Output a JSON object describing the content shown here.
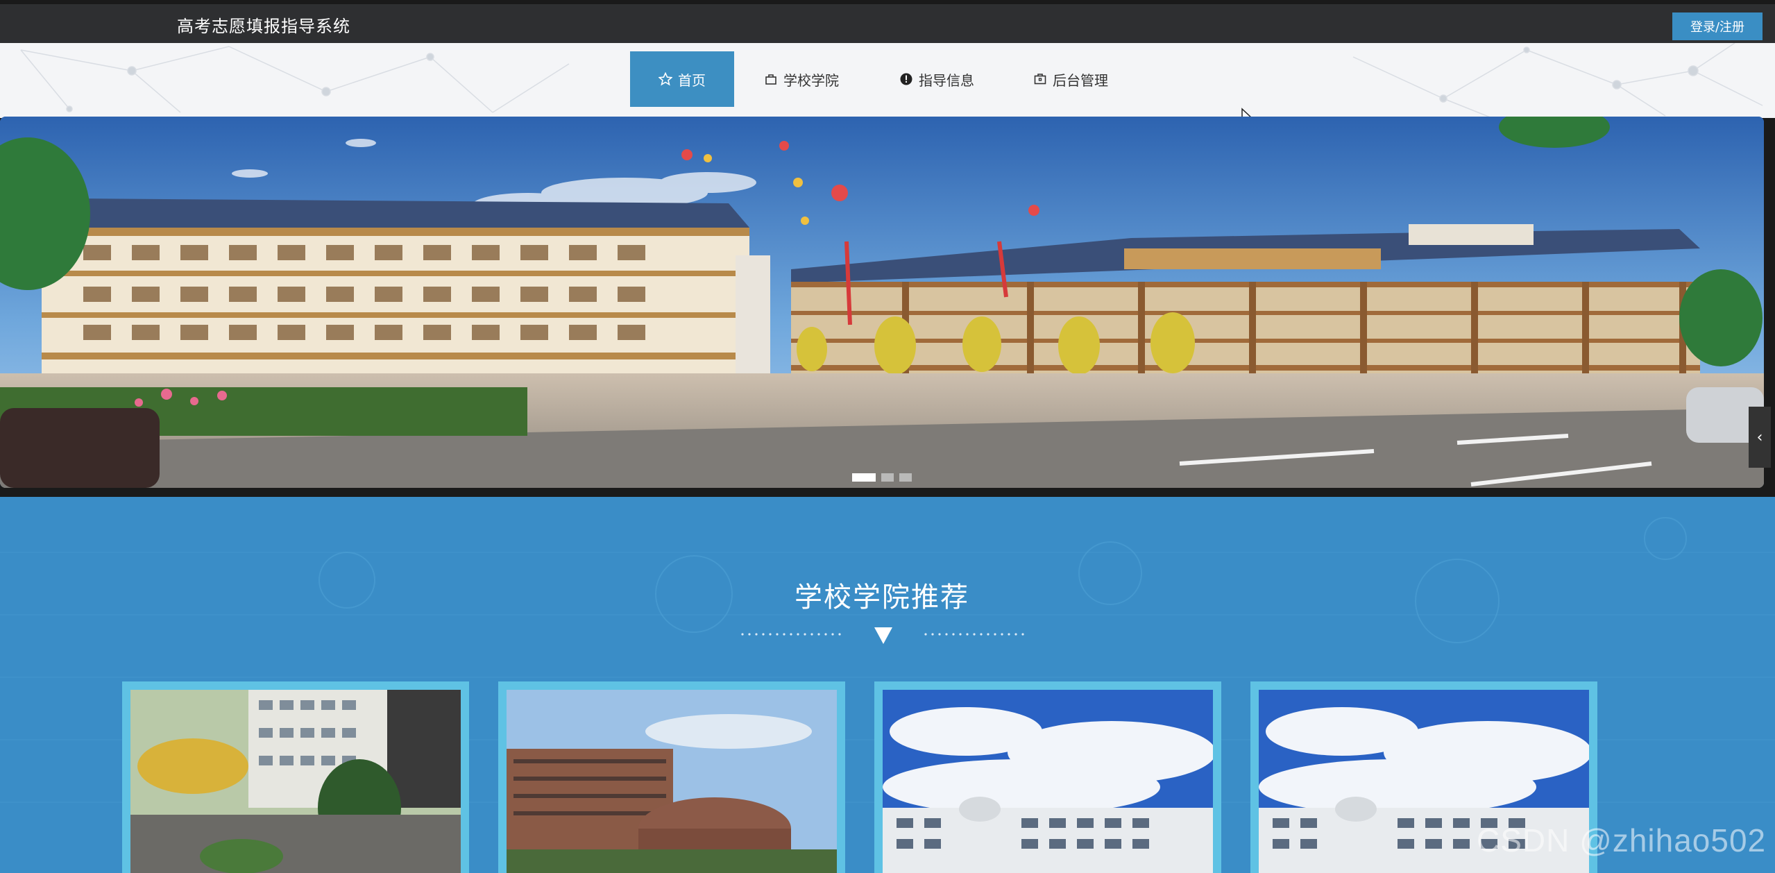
{
  "header": {
    "site_title": "高考志愿填报指导系统",
    "login_label": "登录/注册"
  },
  "nav": {
    "items": [
      {
        "label": "首页",
        "icon": "star-icon",
        "active": true
      },
      {
        "label": "学校学院",
        "icon": "bag-icon",
        "active": false
      },
      {
        "label": "指导信息",
        "icon": "info-icon",
        "active": false
      },
      {
        "label": "后台管理",
        "icon": "briefcase-icon",
        "active": false
      }
    ]
  },
  "banner": {
    "slide_count": 3,
    "active_slide": 1
  },
  "recommend": {
    "title": "学校学院推荐",
    "cards": [
      {
        "image": "campus-photo-1"
      },
      {
        "image": "campus-photo-2"
      },
      {
        "image": "campus-photo-3"
      },
      {
        "image": "campus-photo-4"
      }
    ]
  },
  "watermark": "CSDN @zhihao502",
  "colors": {
    "topbar": "#2e2f31",
    "accent": "#3d8fc2",
    "section_bg": "#3a8dc7",
    "card_border": "#5fc2e4"
  }
}
